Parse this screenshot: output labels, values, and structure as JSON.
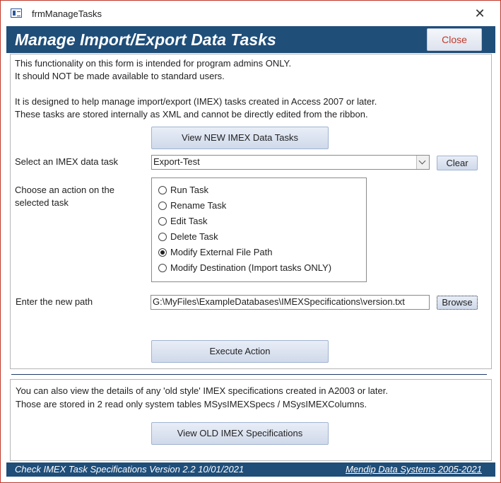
{
  "window": {
    "title": "frmManageTasks"
  },
  "header": {
    "title": "Manage Import/Export Data Tasks",
    "close_label": "Close"
  },
  "intro": {
    "line1": "This functionality on this form is intended for program admins ONLY.",
    "line2": "It should NOT be made available to standard users.",
    "line3": "It is designed to help manage import/export (IMEX) tasks created in Access 2007 or later.",
    "line4": "These tasks are stored internally as XML and cannot be directly edited from the ribbon."
  },
  "view_new_button": "View NEW IMEX Data Tasks",
  "select_task": {
    "label": "Select an IMEX data task",
    "value": "Export-Test",
    "clear_label": "Clear"
  },
  "action": {
    "label_line1": "Choose an action on the",
    "label_line2": "selected task",
    "options": [
      {
        "label": "Run Task",
        "selected": false
      },
      {
        "label": "Rename Task",
        "selected": false
      },
      {
        "label": "Edit Task",
        "selected": false
      },
      {
        "label": "Delete Task",
        "selected": false
      },
      {
        "label": "Modify External File Path",
        "selected": true
      },
      {
        "label": "Modify Destination (Import tasks ONLY)",
        "selected": false
      }
    ]
  },
  "new_path": {
    "label": "Enter the new path",
    "value": "G:\\MyFiles\\ExampleDatabases\\IMEXSpecifications\\version.txt",
    "browse_label": "Browse"
  },
  "execute_label": "Execute Action",
  "old": {
    "line1": "You can also view the details of any 'old style' IMEX specifications created in A2003 or later.",
    "line2": "Those are stored in 2 read only system tables MSysIMEXSpecs / MSysIMEXColumns.",
    "button_label": "View OLD IMEX Specifications"
  },
  "footer": {
    "left": "Check IMEX Task Specifications Version 2.2  10/01/2021",
    "right": "Mendip Data Systems 2005-2021"
  },
  "colors": {
    "header_bg": "#1f4e79",
    "close_text": "#c0392b",
    "window_border": "#c0392b"
  }
}
